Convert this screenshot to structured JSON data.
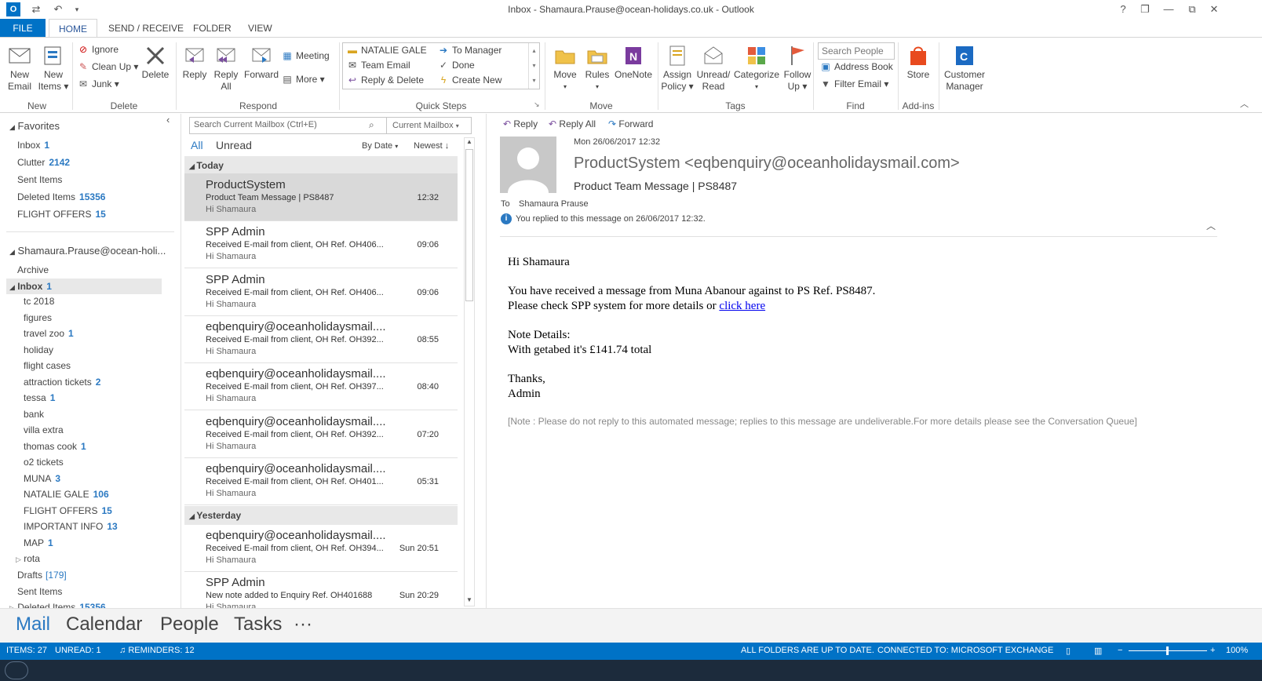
{
  "window": {
    "title": "Inbox - Shamaura.Prause@ocean-holidays.co.uk - Outlook",
    "controls": [
      "?",
      "❐",
      "—",
      "⧉",
      "✕"
    ]
  },
  "tabs": [
    {
      "label": "FILE"
    },
    {
      "label": "HOME"
    },
    {
      "label": "SEND / RECEIVE"
    },
    {
      "label": "FOLDER"
    },
    {
      "label": "VIEW"
    }
  ],
  "ribbon": {
    "new": {
      "new_email": "New\nEmail",
      "new_email_l1": "New",
      "new_email_l2": "Email",
      "new_items_l1": "New",
      "new_items_l2": "Items",
      "label": "New"
    },
    "delete": {
      "ignore": "Ignore",
      "clean_up": "Clean Up",
      "junk": "Junk",
      "delete": "Delete",
      "label": "Delete"
    },
    "respond": {
      "reply": "Reply",
      "reply_all_l1": "Reply",
      "reply_all_l2": "All",
      "forward": "Forward",
      "meeting": "Meeting",
      "more": "More",
      "label": "Respond"
    },
    "quick_steps": {
      "items": [
        "NATALIE GALE",
        "Team Email",
        "Reply & Delete",
        "To Manager",
        "Done",
        "Create New"
      ],
      "label": "Quick Steps"
    },
    "move": {
      "move": "Move",
      "rules": "Rules",
      "onenote": "OneNote",
      "label": "Move"
    },
    "tags": {
      "assign_l1": "Assign",
      "assign_l2": "Policy",
      "unread_l1": "Unread/",
      "unread_l2": "Read",
      "categorize": "Categorize",
      "follow_l1": "Follow",
      "follow_l2": "Up",
      "label": "Tags"
    },
    "find": {
      "search_placeholder": "Search People",
      "address_book": "Address Book",
      "filter_email": "Filter Email",
      "label": "Find"
    },
    "addins": {
      "store": "Store",
      "label": "Add-ins"
    },
    "customer": {
      "l1": "Customer",
      "l2": "Manager"
    }
  },
  "folders": {
    "favorites_head": "Favorites",
    "favorites": [
      {
        "name": "Inbox",
        "count": "1"
      },
      {
        "name": "Clutter",
        "count": "2142"
      },
      {
        "name": "Sent Items",
        "count": ""
      },
      {
        "name": "Deleted Items",
        "count": "15356"
      },
      {
        "name": "FLIGHT OFFERS",
        "count": "15"
      }
    ],
    "account_head": "Shamaura.Prause@ocean-holi...",
    "archive": "Archive",
    "inbox": {
      "name": "Inbox",
      "count": "1"
    },
    "subfolders": [
      {
        "name": "tc 2018",
        "count": ""
      },
      {
        "name": "figures",
        "count": ""
      },
      {
        "name": "travel zoo",
        "count": "1"
      },
      {
        "name": "holiday",
        "count": ""
      },
      {
        "name": "flight cases",
        "count": ""
      },
      {
        "name": "attraction tickets",
        "count": "2"
      },
      {
        "name": "tessa",
        "count": "1"
      },
      {
        "name": "bank",
        "count": ""
      },
      {
        "name": "villa extra",
        "count": ""
      },
      {
        "name": "thomas cook",
        "count": "1"
      },
      {
        "name": "o2 tickets",
        "count": ""
      },
      {
        "name": "MUNA",
        "count": "3"
      },
      {
        "name": "NATALIE GALE",
        "count": "106"
      },
      {
        "name": "FLIGHT OFFERS",
        "count": "15"
      },
      {
        "name": "IMPORTANT INFO",
        "count": "13"
      },
      {
        "name": "MAP",
        "count": "1"
      }
    ],
    "rota": "rota",
    "drafts": {
      "name": "Drafts",
      "count": "[179]"
    },
    "sent": "Sent Items",
    "deleted_partial": {
      "name": "Deleted Items",
      "count": "15356"
    }
  },
  "message_list": {
    "search_placeholder": "Search Current Mailbox (Ctrl+E)",
    "scope": "Current Mailbox",
    "filter_all": "All",
    "filter_unread": "Unread",
    "sort_by": "By Date",
    "sort_order": "Newest",
    "group_today": "Today",
    "group_yesterday": "Yesterday",
    "messages": [
      {
        "from": "ProductSystem",
        "subject": "Product Team Message | PS8487",
        "preview": "Hi Shamaura",
        "time": "12:32"
      },
      {
        "from": "SPP Admin",
        "subject": "Received E-mail from client, OH Ref. OH406...",
        "preview": "Hi Shamaura",
        "time": "09:06"
      },
      {
        "from": "SPP Admin",
        "subject": "Received E-mail from client, OH Ref. OH406...",
        "preview": "Hi Shamaura",
        "time": "09:06"
      },
      {
        "from": "eqbenquiry@oceanholidaysmail....",
        "subject": "Received E-mail from client, OH Ref. OH392...",
        "preview": "Hi Shamaura",
        "time": "08:55"
      },
      {
        "from": "eqbenquiry@oceanholidaysmail....",
        "subject": "Received E-mail from client, OH Ref. OH397...",
        "preview": "Hi Shamaura",
        "time": "08:40"
      },
      {
        "from": "eqbenquiry@oceanholidaysmail....",
        "subject": "Received E-mail from client, OH Ref. OH392...",
        "preview": "Hi Shamaura",
        "time": "07:20"
      },
      {
        "from": "eqbenquiry@oceanholidaysmail....",
        "subject": "Received E-mail from client, OH Ref. OH401...",
        "preview": "Hi Shamaura",
        "time": "05:31"
      },
      {
        "from": "eqbenquiry@oceanholidaysmail....",
        "subject": "Received E-mail from client, OH Ref. OH394...",
        "preview": "Hi Shamaura",
        "time": "Sun 20:51"
      },
      {
        "from": "SPP Admin",
        "subject": "New note added to Enquiry Ref. OH401688",
        "preview": "Hi Shamaura",
        "time": "Sun 20:29"
      }
    ]
  },
  "reading": {
    "reply": "Reply",
    "reply_all": "Reply All",
    "forward": "Forward",
    "date": "Mon 26/06/2017 12:32",
    "sender": "ProductSystem <eqbenquiry@oceanholidaysmail.com>",
    "subject": "Product Team Message | PS8487",
    "to_label": "To",
    "to": "Shamaura Prause",
    "info": "You replied to this message on 26/06/2017 12:32.",
    "body": {
      "greeting": "Hi Shamaura",
      "line1": "You have received a message from Muna Abanour against to PS Ref. PS8487.",
      "line2_pre": "Please check SPP system for more details or ",
      "link": "click here",
      "note_head": "Note Details:",
      "note": "With getabed it's £141.74 total",
      "thanks": "Thanks,",
      "sign": "Admin",
      "footer": "[Note : Please do not reply to this automated message; replies to this message are undeliverable.For more details please see the Conversation Queue]"
    }
  },
  "nav": {
    "mail": "Mail",
    "calendar": "Calendar",
    "people": "People",
    "tasks": "Tasks",
    "more": "···"
  },
  "status": {
    "items": "ITEMS: 27",
    "unread": "UNREAD: 1",
    "reminders": "REMINDERS: 12",
    "sync": "ALL FOLDERS ARE UP TO DATE.",
    "connection": "CONNECTED TO: MICROSOFT EXCHANGE",
    "zoom": "100%"
  },
  "colors": {
    "accent": "#0072c6",
    "count": "#2b79c2",
    "link": "#0000ee"
  }
}
